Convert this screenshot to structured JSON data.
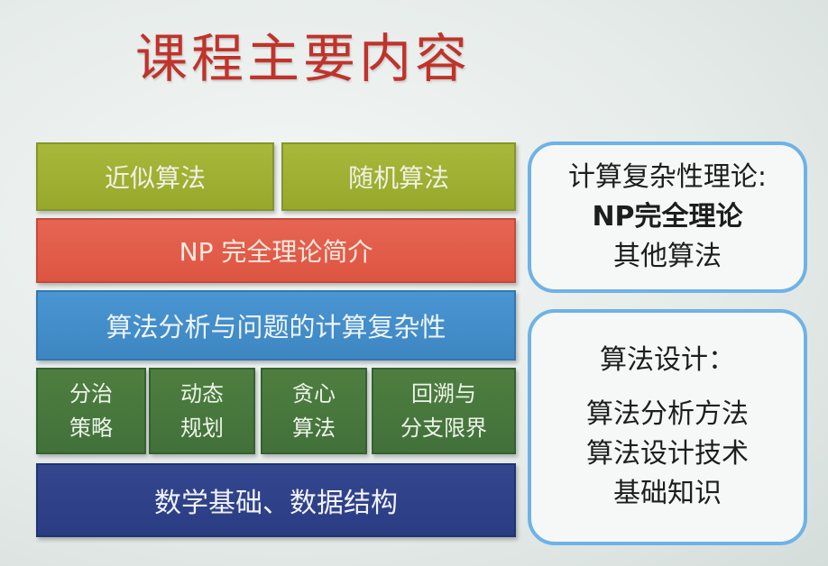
{
  "title": "课程主要内容",
  "layers": {
    "approx": "近似算法",
    "random": "随机算法",
    "np_intro": "NP 完全理论简介",
    "analysis": "算法分析与问题的计算复杂性",
    "divide": "分治\n策略",
    "dynamic": "动态\n规划",
    "greedy": "贪心\n算法",
    "backtrack": "回溯与\n分支限界",
    "foundation": "数学基础、数据结构"
  },
  "panel_complexity": {
    "heading": "计算复杂性理论:",
    "line1": "NP完全理论",
    "line2": "其他算法"
  },
  "panel_design": {
    "heading": "算法设计：",
    "line1": "算法分析方法",
    "line2": "算法设计技术",
    "line3": "基础知识"
  },
  "colors": {
    "title": "#c0332a",
    "olive": "#a7b83a",
    "red": "#e66552",
    "blue": "#4a96d2",
    "green": "#4e7f3f",
    "navy": "#34478f",
    "panel_border": "#6fb2e6"
  }
}
